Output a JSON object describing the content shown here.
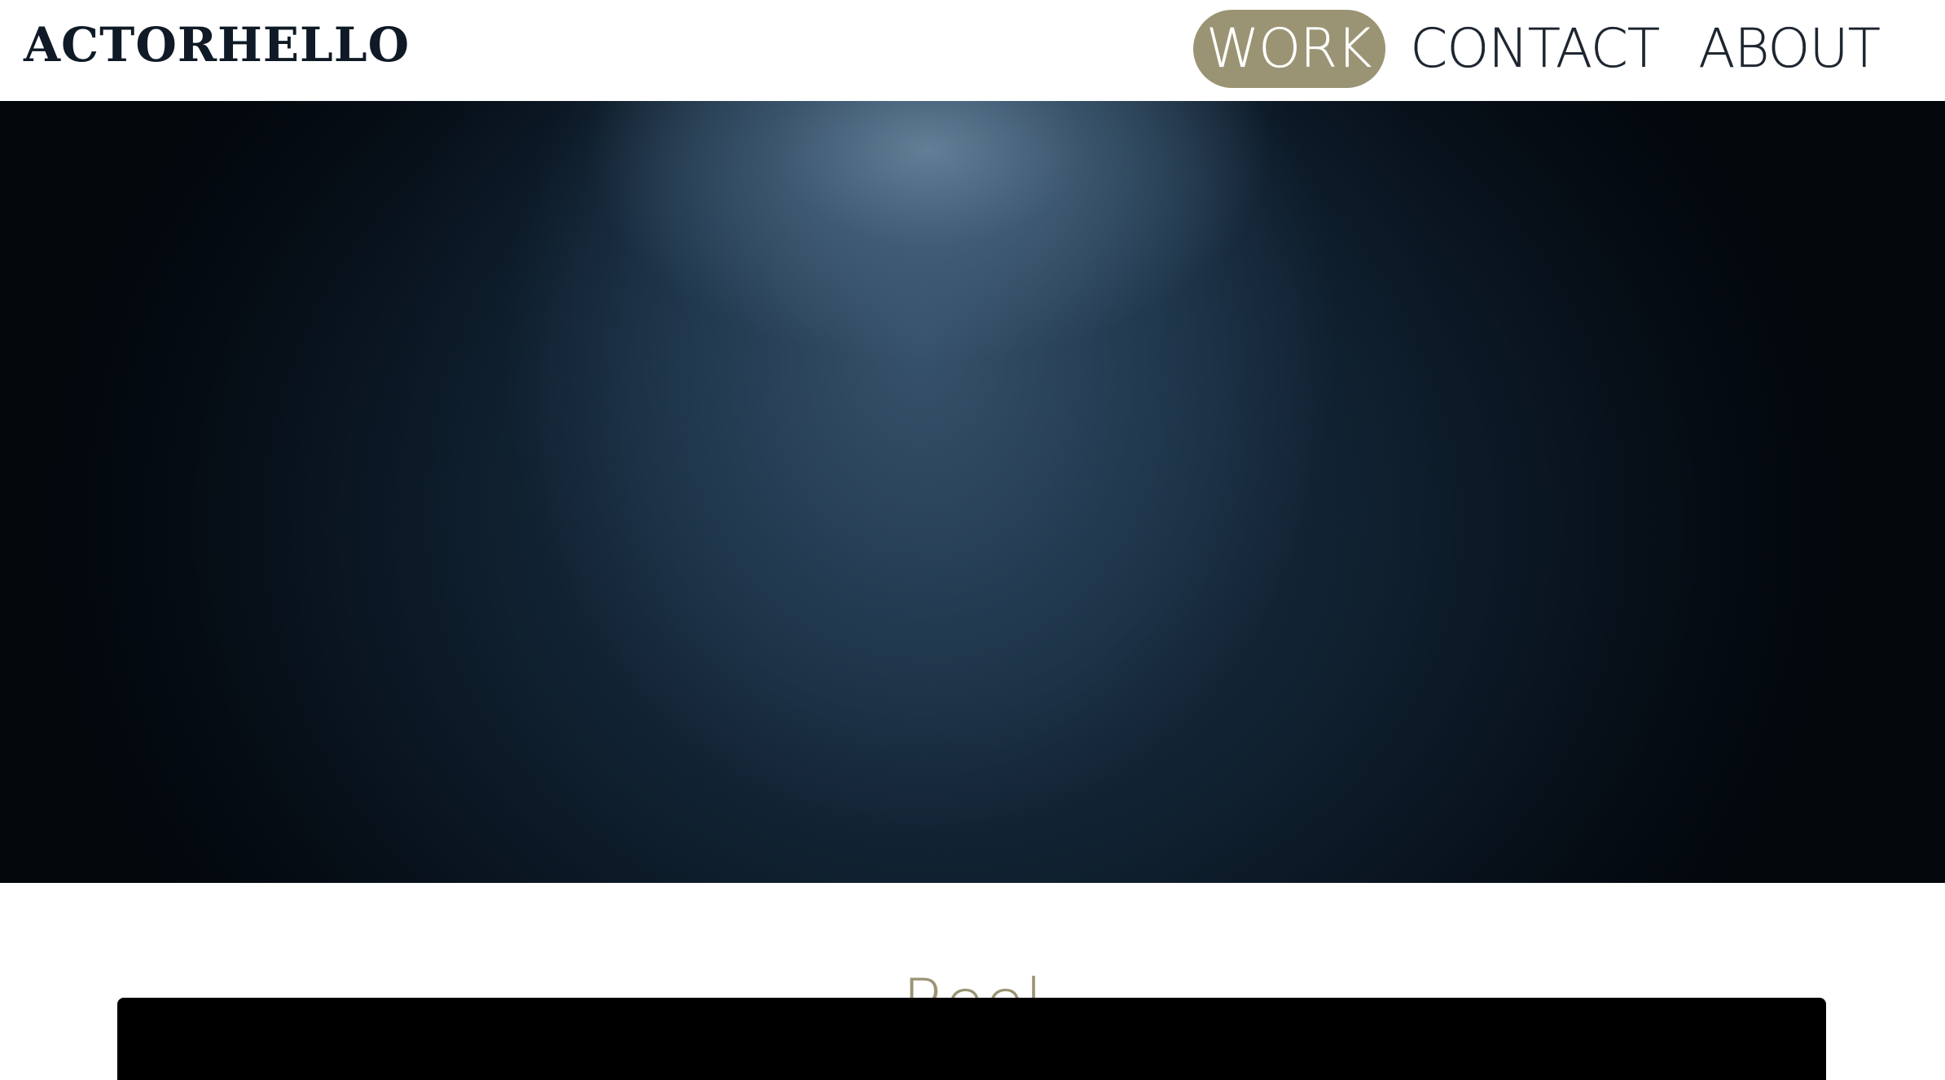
{
  "header": {
    "logo_text": "ACTORHELLO",
    "nav": [
      {
        "label": "WORK",
        "active": true
      },
      {
        "label": "CONTACT",
        "active": false
      },
      {
        "label": "ABOUT",
        "active": false
      }
    ]
  },
  "main": {
    "section_title": "Reel"
  },
  "colors": {
    "accent": "#9a9474",
    "logo": "#0f1a26",
    "nav_text": "#1d2530",
    "background": "#ffffff",
    "hero_dark": "#030a12",
    "video_bg": "#000000"
  }
}
